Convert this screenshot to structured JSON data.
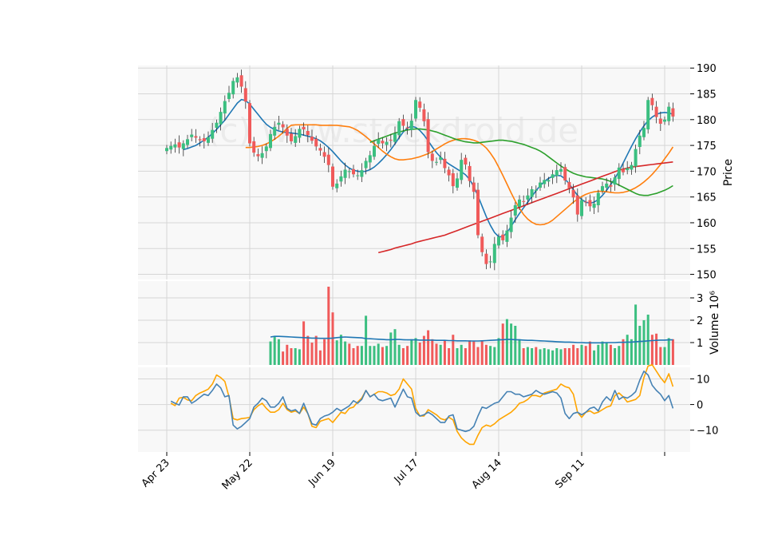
{
  "watermark": "(c) www.stockdroid.de",
  "chart_data": [
    {
      "type": "candlestick",
      "panel": "price",
      "ylabel": "Price",
      "ylim": [
        149,
        190.5
      ],
      "yticks": [
        150,
        155,
        160,
        165,
        170,
        175,
        180,
        185,
        190
      ],
      "x_ticks": [
        {
          "index": 0,
          "label": "Apr 23"
        },
        {
          "index": 20,
          "label": "May 22"
        },
        {
          "index": 40,
          "label": "Jun 19"
        },
        {
          "index": 60,
          "label": "Jul 17"
        },
        {
          "index": 80,
          "label": "Aug 14"
        },
        {
          "index": 100,
          "label": "Sep 11"
        },
        {
          "index": 120,
          "label": ""
        }
      ],
      "grid": true,
      "up_color": "#3bbf80",
      "down_color": "#f05a5a",
      "closes": [
        174.5,
        174.9,
        175.2,
        174.6,
        175.4,
        176.2,
        177.1,
        176.5,
        176.0,
        175.8,
        176.6,
        178.0,
        179.4,
        181.5,
        183.6,
        185.2,
        187.5,
        188.2,
        186.4,
        183.5,
        175.4,
        173.6,
        172.9,
        173.5,
        174.8,
        177.2,
        178.6,
        179.4,
        178.5,
        176.9,
        175.8,
        176.8,
        178.2,
        178.1,
        177.0,
        175.9,
        174.8,
        174.0,
        172.8,
        171.2,
        167.0,
        167.6,
        169.0,
        170.3,
        170.0,
        169.4,
        169.2,
        170.2,
        172.0,
        173.1,
        174.9,
        176.2,
        175.4,
        175.7,
        176.0,
        177.3,
        179.7,
        178.8,
        178.3,
        179.8,
        183.8,
        182.3,
        179.7,
        173.7,
        172.0,
        171.8,
        172.7,
        170.6,
        169.2,
        167.1,
        168.6,
        172.2,
        171.3,
        168.1,
        166.0,
        157.6,
        154.3,
        152.0,
        152.5,
        155.9,
        157.3,
        156.6,
        158.5,
        161.0,
        163.4,
        164.5,
        164.1,
        165.3,
        166.5,
        166.4,
        167.8,
        168.3,
        168.3,
        169.4,
        170.2,
        170.4,
        168.2,
        166.7,
        164.9,
        161.6,
        164.4,
        164.0,
        163.2,
        163.7,
        165.8,
        167.1,
        167.6,
        167.0,
        168.8,
        170.7,
        169.8,
        170.6,
        171.2,
        174.3,
        176.9,
        178.4,
        183.8,
        182.8,
        180.5,
        179.2,
        180.0,
        182.5,
        180.6
      ]
    },
    {
      "type": "line",
      "panel": "price",
      "series": [
        {
          "color": "#1f77b4",
          "values": [
            174.2,
            174.4,
            174.7,
            175.0,
            175.5,
            176.0,
            176.6,
            177.3,
            178.1,
            179.0,
            179.9,
            181.0,
            182.1,
            183.2,
            183.9,
            183.7,
            183.0,
            182.0,
            181.0,
            180.0,
            179.1,
            178.5,
            178.1,
            177.8,
            177.6,
            177.5,
            177.4,
            177.3,
            177.2,
            177.0,
            176.8,
            176.6,
            176.3,
            175.9,
            175.3,
            174.6,
            173.8,
            172.9,
            172.0,
            171.2,
            170.6,
            170.2,
            170.0,
            169.9,
            170.0,
            170.3,
            170.8,
            171.5,
            172.3,
            173.2,
            174.2,
            175.3,
            176.5,
            177.6,
            178.4,
            178.7,
            178.5,
            177.9,
            177.0,
            175.9,
            174.7,
            173.6,
            172.7,
            172.0,
            171.4,
            170.9,
            170.4,
            169.9,
            169.3,
            168.4,
            167.0,
            165.2,
            163.2,
            161.2,
            159.5,
            158.1,
            157.3,
            157.3,
            158.1,
            159.3,
            160.6,
            161.8,
            162.9,
            164.0,
            165.1,
            166.2,
            167.2,
            168.0,
            168.6,
            169.0,
            169.2,
            169.1,
            168.5,
            167.5,
            166.4,
            165.3,
            164.5,
            164.0,
            163.8,
            164.0,
            164.5,
            165.3,
            166.3,
            167.4,
            168.6,
            170.0,
            171.6,
            173.2,
            174.8,
            176.3,
            177.6,
            178.8,
            179.8,
            180.5,
            181.0,
            181.3,
            181.4,
            181.3,
            181.0
          ]
        },
        {
          "color": "#ff7f0e",
          "values": [
            174.6,
            174.6,
            174.7,
            174.8,
            175.0,
            175.3,
            175.7,
            176.2,
            176.8,
            177.5,
            178.3,
            178.9,
            179.0,
            179.0,
            179.0,
            179.0,
            179.0,
            179.0,
            178.9,
            178.9,
            178.9,
            178.9,
            178.9,
            178.8,
            178.7,
            178.6,
            178.3,
            177.9,
            177.3,
            176.7,
            176.0,
            175.3,
            174.6,
            173.9,
            173.3,
            172.8,
            172.4,
            172.2,
            172.2,
            172.3,
            172.4,
            172.6,
            172.8,
            173.1,
            173.4,
            173.8,
            174.3,
            174.8,
            175.3,
            175.7,
            176.0,
            176.2,
            176.3,
            176.3,
            176.2,
            176.0,
            175.7,
            175.2,
            174.5,
            173.5,
            172.3,
            170.8,
            169.2,
            167.5,
            165.8,
            164.2,
            162.8,
            161.6,
            160.7,
            160.1,
            159.7,
            159.6,
            159.7,
            160.0,
            160.5,
            161.2,
            161.9,
            162.6,
            163.3,
            164.0,
            164.6,
            165.1,
            165.5,
            165.8,
            166.0,
            166.1,
            166.1,
            166.0,
            165.9,
            165.8,
            165.8,
            165.9,
            166.1,
            166.4,
            166.8,
            167.3,
            167.9,
            168.6,
            169.4,
            170.3,
            171.3,
            172.4,
            173.5,
            174.7
          ]
        },
        {
          "color": "#2ca02c",
          "values": [
            175.6,
            175.9,
            176.2,
            176.5,
            176.8,
            177.1,
            177.4,
            177.6,
            177.8,
            178.0,
            178.1,
            178.2,
            178.2,
            178.1,
            178.0,
            177.8,
            177.6,
            177.3,
            177.0,
            176.7,
            176.4,
            176.1,
            175.9,
            175.7,
            175.6,
            175.5,
            175.5,
            175.6,
            175.7,
            175.8,
            175.9,
            176.0,
            176.0,
            175.9,
            175.8,
            175.6,
            175.4,
            175.2,
            174.9,
            174.6,
            174.3,
            173.9,
            173.4,
            172.8,
            172.2,
            171.6,
            171.0,
            170.5,
            170.0,
            169.6,
            169.3,
            169.1,
            168.9,
            168.8,
            168.7,
            168.6,
            168.5,
            168.3,
            168.0,
            167.7,
            167.3,
            166.9,
            166.5,
            166.1,
            165.7,
            165.4,
            165.3,
            165.3,
            165.5,
            165.7,
            166.0,
            166.3,
            166.7,
            167.2
          ]
        },
        {
          "color": "#d62728",
          "values": [
            154.2,
            154.4,
            154.6,
            154.8,
            155.1,
            155.3,
            155.5,
            155.7,
            155.9,
            156.2,
            156.4,
            156.6,
            156.8,
            157.0,
            157.2,
            157.4,
            157.6,
            157.9,
            158.2,
            158.5,
            158.8,
            159.1,
            159.4,
            159.7,
            160.0,
            160.3,
            160.6,
            160.9,
            161.2,
            161.5,
            161.8,
            162.1,
            162.4,
            162.7,
            163.0,
            163.3,
            163.6,
            163.9,
            164.2,
            164.5,
            164.8,
            165.1,
            165.4,
            165.7,
            166.0,
            166.3,
            166.6,
            166.9,
            167.2,
            167.5,
            167.8,
            168.1,
            168.4,
            168.7,
            169.0,
            169.3,
            169.6,
            169.9,
            170.2,
            170.4,
            170.6,
            170.8,
            170.9,
            171.0,
            171.1,
            171.2,
            171.3,
            171.4,
            171.5,
            171.6,
            171.7,
            171.8
          ]
        }
      ]
    },
    {
      "type": "bar",
      "panel": "volume",
      "ylabel": "Volume  10⁶",
      "ylim": [
        0,
        3.75
      ],
      "yticks": [
        1,
        2,
        3
      ],
      "values": [
        1.05,
        1.25,
        1.15,
        0.6,
        0.9,
        0.75,
        0.75,
        0.7,
        1.95,
        1.3,
        1.0,
        1.3,
        0.65,
        1.15,
        3.5,
        2.35,
        1.1,
        1.35,
        1.05,
        0.95,
        0.75,
        0.85,
        0.85,
        2.2,
        0.85,
        0.85,
        0.95,
        0.8,
        0.85,
        1.45,
        1.6,
        0.9,
        0.75,
        0.85,
        1.15,
        1.2,
        1.0,
        1.3,
        1.55,
        1.15,
        0.95,
        0.9,
        1.1,
        0.75,
        1.35,
        0.75,
        0.9,
        0.75,
        1.1,
        1.05,
        0.8,
        1.1,
        0.9,
        0.85,
        0.8,
        1.2,
        1.85,
        2.05,
        1.85,
        1.75,
        1.15,
        0.75,
        0.8,
        0.75,
        0.8,
        0.7,
        0.75,
        0.7,
        0.65,
        0.75,
        0.7,
        0.75,
        0.75,
        0.9,
        0.75,
        0.9,
        0.85,
        1.05,
        0.65,
        0.9,
        1.05,
        1.0,
        0.9,
        0.75,
        0.85,
        1.15,
        1.35,
        1.15,
        2.7,
        1.75,
        2.0,
        2.25,
        1.35,
        1.4,
        0.8,
        0.8,
        1.2,
        1.15
      ],
      "ma_values": [
        1.25,
        1.28,
        1.28,
        1.27,
        1.26,
        1.25,
        1.24,
        1.23,
        1.22,
        1.21,
        1.2,
        1.2,
        1.19,
        1.19,
        1.19,
        1.2,
        1.22,
        1.24,
        1.25,
        1.24,
        1.23,
        1.22,
        1.21,
        1.18,
        1.17,
        1.16,
        1.15,
        1.14,
        1.13,
        1.13,
        1.14,
        1.14,
        1.13,
        1.12,
        1.12,
        1.12,
        1.11,
        1.11,
        1.11,
        1.11,
        1.1,
        1.1,
        1.1,
        1.09,
        1.09,
        1.08,
        1.08,
        1.08,
        1.07,
        1.07,
        1.07,
        1.08,
        1.09,
        1.1,
        1.11,
        1.12,
        1.13,
        1.14,
        1.14,
        1.13,
        1.12,
        1.11,
        1.1,
        1.1,
        1.09,
        1.08,
        1.07,
        1.06,
        1.05,
        1.04,
        1.03,
        1.02,
        1.02,
        1.01,
        1.0,
        1.0,
        0.99,
        0.99,
        0.99,
        0.99,
        0.99,
        1.0,
        1.0,
        1.0,
        1.01,
        1.01,
        1.02,
        1.02,
        1.04,
        1.05,
        1.06,
        1.08,
        1.09,
        1.1,
        1.11,
        1.11,
        1.12,
        1.12
      ]
    },
    {
      "type": "line",
      "panel": "oscillator",
      "ylim": [
        -18.5,
        14.5
      ],
      "yticks": [
        -10,
        0,
        10
      ],
      "series": [
        {
          "color": "#ffa500",
          "values": [
            0.5,
            -0.4,
            2.5,
            2.8,
            1.8,
            1.5,
            3.5,
            4.5,
            5.2,
            6.0,
            8.0,
            11.5,
            10.5,
            9.0,
            3.0,
            -5.5,
            -6.0,
            -5.5,
            -5.3,
            -5.0,
            -2.0,
            -0.5,
            0.5,
            -1.5,
            -3.0,
            -3.0,
            -2.0,
            0.5,
            -2.0,
            -3.0,
            -2.5,
            -3.5,
            -1.0,
            -3.5,
            -8.5,
            -9.0,
            -6.5,
            -6.0,
            -5.5,
            -7.0,
            -5.0,
            -3.0,
            -3.5,
            -1.5,
            -1.0,
            1.0,
            2.5,
            5.5,
            3.0,
            4.0,
            5.0,
            5.0,
            4.5,
            3.5,
            4.0,
            6.0,
            10.0,
            8.0,
            6.0,
            -1.5,
            -4.5,
            -4.5,
            -2.0,
            -3.0,
            -4.0,
            -5.5,
            -6.0,
            -5.0,
            -6.0,
            -10.5,
            -13.0,
            -14.5,
            -15.5,
            -15.5,
            -12.0,
            -9.0,
            -8.0,
            -8.5,
            -7.5,
            -6.0,
            -5.0,
            -4.0,
            -3.0,
            -1.5,
            0.5,
            1.0,
            2.0,
            3.5,
            3.5,
            3.0,
            4.5,
            5.0,
            5.5,
            6.0,
            8.0,
            7.0,
            6.5,
            4.0,
            -3.0,
            -5.0,
            -3.0,
            -2.5,
            -3.5,
            -3.0,
            -2.0,
            -1.0,
            -0.5,
            3.5,
            4.5,
            3.0,
            1.0,
            1.5,
            2.0,
            3.5,
            10.5,
            15.0,
            15.5,
            13.0,
            10.5,
            8.5,
            12.0,
            7.0
          ]
        },
        {
          "color": "#4682b4",
          "values": [
            1.3,
            0.5,
            -0.2,
            3.0,
            3.0,
            0.5,
            1.5,
            2.8,
            4.0,
            3.5,
            5.5,
            8.0,
            6.5,
            3.0,
            3.5,
            -8.0,
            -9.5,
            -8.5,
            -7.0,
            -5.5,
            -1.0,
            0.5,
            2.5,
            1.5,
            -1.0,
            -1.0,
            0.5,
            3.0,
            -1.5,
            -2.5,
            -2.0,
            -3.5,
            0.5,
            -3.5,
            -7.5,
            -8.0,
            -5.5,
            -4.5,
            -4.0,
            -3.0,
            -1.5,
            -2.5,
            -1.5,
            -0.5,
            1.5,
            0.5,
            2.0,
            5.5,
            3.0,
            4.0,
            2.0,
            1.5,
            2.0,
            2.5,
            -1.0,
            2.5,
            6.0,
            3.0,
            2.5,
            -3.0,
            -4.5,
            -4.0,
            -3.0,
            -4.0,
            -5.5,
            -7.0,
            -7.0,
            -4.5,
            -4.0,
            -9.5,
            -10.0,
            -10.5,
            -10.0,
            -8.5,
            -4.5,
            -1.0,
            -1.5,
            -0.5,
            0.5,
            1.0,
            3.0,
            5.0,
            5.0,
            4.0,
            4.0,
            3.0,
            3.5,
            4.0,
            5.5,
            4.5,
            4.0,
            4.5,
            5.0,
            4.5,
            2.5,
            -3.5,
            -5.5,
            -3.5,
            -3.0,
            -4.0,
            -3.0,
            -1.5,
            -1.0,
            -2.5,
            1.0,
            3.0,
            1.5,
            5.5,
            2.0,
            3.0,
            2.5,
            3.5,
            5.0,
            9.5,
            13.0,
            11.5,
            7.5,
            5.5,
            4.0,
            1.5,
            3.5,
            -1.5
          ]
        }
      ]
    }
  ]
}
